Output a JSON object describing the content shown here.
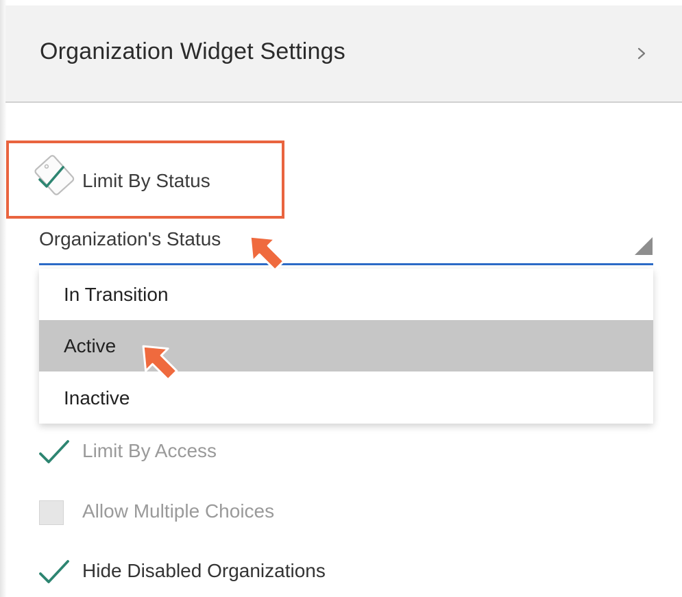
{
  "header": {
    "title": "Organization Widget Settings",
    "chevron_icon": "chevron-right-icon"
  },
  "limit_by_status": {
    "label": "Limit By Status",
    "checked": true,
    "icon": "tag-check-icon"
  },
  "status_field": {
    "label": "Organization's Status",
    "caret_icon": "dropdown-caret-icon"
  },
  "dropdown": {
    "options": [
      "In Transition",
      "Active",
      "Inactive"
    ],
    "highlighted": "Active"
  },
  "options": {
    "limit_by_access": {
      "label": "Limit By Access",
      "checked": true
    },
    "allow_multiple": {
      "label": "Allow Multiple Choices",
      "checked": false
    },
    "hide_disabled": {
      "label": "Hide Disabled Organizations",
      "checked": true
    }
  },
  "colors": {
    "accent_orange": "#e9643f",
    "underline_blue": "#2c6bc7",
    "check_teal": "#2d8571",
    "highlight_gray": "#c6c6c6",
    "header_bg": "#f2f2f2"
  }
}
